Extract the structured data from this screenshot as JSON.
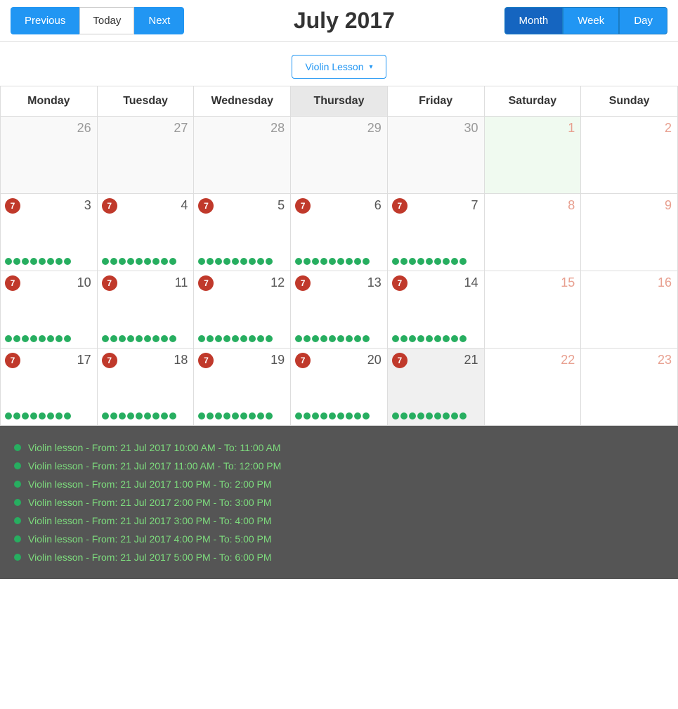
{
  "header": {
    "prev_label": "Previous",
    "today_label": "Today",
    "next_label": "Next",
    "title": "July 2017",
    "views": [
      "Month",
      "Week",
      "Day"
    ],
    "active_view": "Month"
  },
  "filter": {
    "label": "Violin Lesson",
    "arrow": "▾"
  },
  "calendar": {
    "days": [
      "Monday",
      "Tuesday",
      "Wednesday",
      "Thursday",
      "Friday",
      "Saturday",
      "Sunday"
    ],
    "highlight_day": "Thursday",
    "weeks": [
      {
        "cells": [
          {
            "date": "26",
            "month": "prev",
            "badge": null,
            "dots": 0
          },
          {
            "date": "27",
            "month": "prev",
            "badge": null,
            "dots": 0
          },
          {
            "date": "28",
            "month": "prev",
            "badge": null,
            "dots": 0
          },
          {
            "date": "29",
            "month": "prev",
            "badge": null,
            "dots": 0
          },
          {
            "date": "30",
            "month": "prev",
            "badge": null,
            "dots": 0
          },
          {
            "date": "1",
            "month": "curr",
            "today": true,
            "badge": null,
            "dots": 0
          },
          {
            "date": "2",
            "month": "curr",
            "badge": null,
            "dots": 0
          }
        ]
      },
      {
        "cells": [
          {
            "date": "3",
            "month": "curr",
            "badge": "7",
            "dots": 8
          },
          {
            "date": "4",
            "month": "curr",
            "badge": "7",
            "dots": 9
          },
          {
            "date": "5",
            "month": "curr",
            "badge": "7",
            "dots": 9
          },
          {
            "date": "6",
            "month": "curr",
            "badge": "7",
            "dots": 9
          },
          {
            "date": "7",
            "month": "curr",
            "badge": "7",
            "dots": 9
          },
          {
            "date": "8",
            "month": "curr",
            "badge": null,
            "dots": 0
          },
          {
            "date": "9",
            "month": "curr",
            "badge": null,
            "dots": 0
          }
        ]
      },
      {
        "cells": [
          {
            "date": "10",
            "month": "curr",
            "badge": "7",
            "dots": 8
          },
          {
            "date": "11",
            "month": "curr",
            "badge": "7",
            "dots": 9
          },
          {
            "date": "12",
            "month": "curr",
            "badge": "7",
            "dots": 9
          },
          {
            "date": "13",
            "month": "curr",
            "badge": "7",
            "dots": 9
          },
          {
            "date": "14",
            "month": "curr",
            "badge": "7",
            "dots": 9
          },
          {
            "date": "15",
            "month": "curr",
            "badge": null,
            "dots": 0
          },
          {
            "date": "16",
            "month": "curr",
            "badge": null,
            "dots": 0
          }
        ]
      },
      {
        "cells": [
          {
            "date": "17",
            "month": "curr",
            "badge": "7",
            "dots": 8
          },
          {
            "date": "18",
            "month": "curr",
            "badge": "7",
            "dots": 9
          },
          {
            "date": "19",
            "month": "curr",
            "badge": "7",
            "dots": 9
          },
          {
            "date": "20",
            "month": "curr",
            "badge": "7",
            "dots": 9
          },
          {
            "date": "21",
            "month": "curr",
            "badge": "7",
            "dots": 9,
            "selected": true
          },
          {
            "date": "22",
            "month": "curr",
            "badge": null,
            "dots": 0
          },
          {
            "date": "23",
            "month": "curr",
            "badge": null,
            "dots": 0
          }
        ]
      }
    ]
  },
  "events": [
    {
      "label": "Violin lesson - From: 21 Jul 2017 10:00 AM - To: 11:00 AM"
    },
    {
      "label": "Violin lesson - From: 21 Jul 2017 11:00 AM - To: 12:00 PM"
    },
    {
      "label": "Violin lesson - From: 21 Jul 2017 1:00 PM - To: 2:00 PM"
    },
    {
      "label": "Violin lesson - From: 21 Jul 2017 2:00 PM - To: 3:00 PM"
    },
    {
      "label": "Violin lesson - From: 21 Jul 2017 3:00 PM - To: 4:00 PM"
    },
    {
      "label": "Violin lesson - From: 21 Jul 2017 4:00 PM - To: 5:00 PM"
    },
    {
      "label": "Violin lesson - From: 21 Jul 2017 5:00 PM - To: 6:00 PM"
    }
  ]
}
